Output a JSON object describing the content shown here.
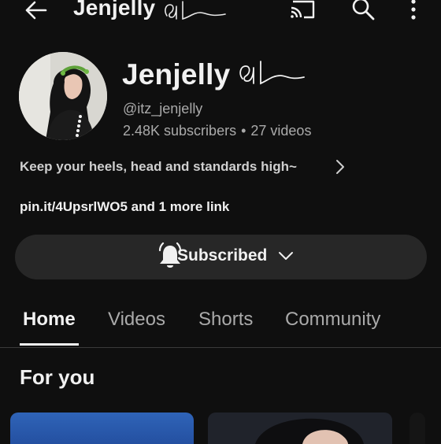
{
  "header": {
    "title": "Jenjelly"
  },
  "channel": {
    "name": "Jenjelly",
    "handle": "@itz_jenjelly",
    "subscribers": "2.48K subscribers",
    "separator": "•",
    "videos": "27 videos",
    "description": "Keep your heels, head and standards high~",
    "links": "pin.it/4UpsrlWO5 and 1 more link"
  },
  "subscribe_button": {
    "label": "Subscribed"
  },
  "tabs": [
    {
      "label": "Home",
      "active": true
    },
    {
      "label": "Videos",
      "active": false
    },
    {
      "label": "Shorts",
      "active": false
    },
    {
      "label": "Community",
      "active": false
    }
  ],
  "section": {
    "title": "For you"
  },
  "icons": {
    "back": "arrow-left-icon",
    "cast": "cast-icon",
    "search": "search-icon",
    "more": "more-vert-icon",
    "bell": "bell-icon",
    "chevron_right": "chevron-right-icon",
    "chevron_down": "chevron-down-icon"
  },
  "colors": {
    "background": "#0f0f0f",
    "text": "#f1f1f1",
    "secondary_text": "#aaaaaa",
    "button_bg": "#272727",
    "card_blue": "#2f64b8"
  }
}
